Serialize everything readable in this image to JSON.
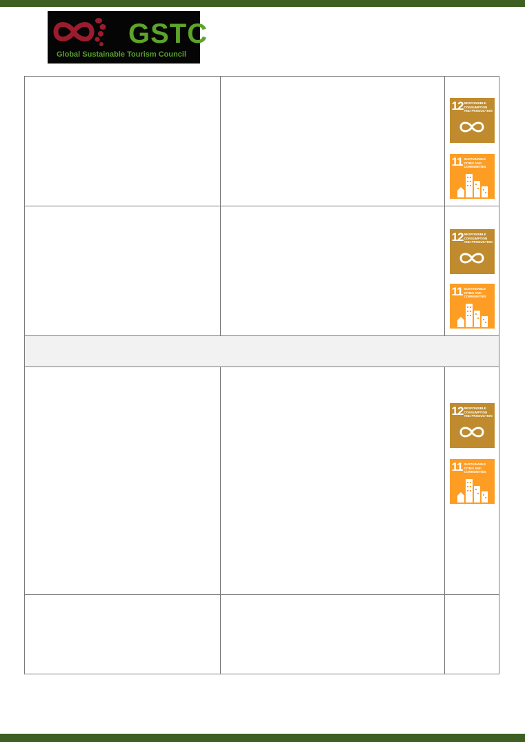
{
  "colors": {
    "bar_green": "#3d5f24",
    "logo_red": "#9b1c2e",
    "logo_green": "#5da42a",
    "logo_tagline_green": "#56a02a",
    "sdg12": "#bf8b2e",
    "sdg11": "#fd9d24",
    "rule": "#7a7a7a"
  },
  "logo": {
    "wordmark": "GSTC",
    "tagline": "Global Sustainable Tourism Council",
    "icon": "gstc-infinity-footprints-icon"
  },
  "sdg_12": {
    "number": "12",
    "title": "RESPONSIBLE CONSUMPTION AND PRODUCTION",
    "icon": "infinity-loop-icon"
  },
  "sdg_11": {
    "number": "11",
    "title": "SUSTAINABLE CITIES AND COMMUNITIES",
    "icon": "city-buildings-icon"
  },
  "table": {
    "rows": [
      {
        "type": "criterion",
        "sdgs": [
          "12",
          "11"
        ]
      },
      {
        "type": "criterion",
        "sdgs": [
          "12",
          "11"
        ]
      },
      {
        "type": "section-header"
      },
      {
        "type": "criterion",
        "sdgs": [
          "12",
          "11"
        ]
      },
      {
        "type": "criterion",
        "sdgs": []
      }
    ]
  }
}
